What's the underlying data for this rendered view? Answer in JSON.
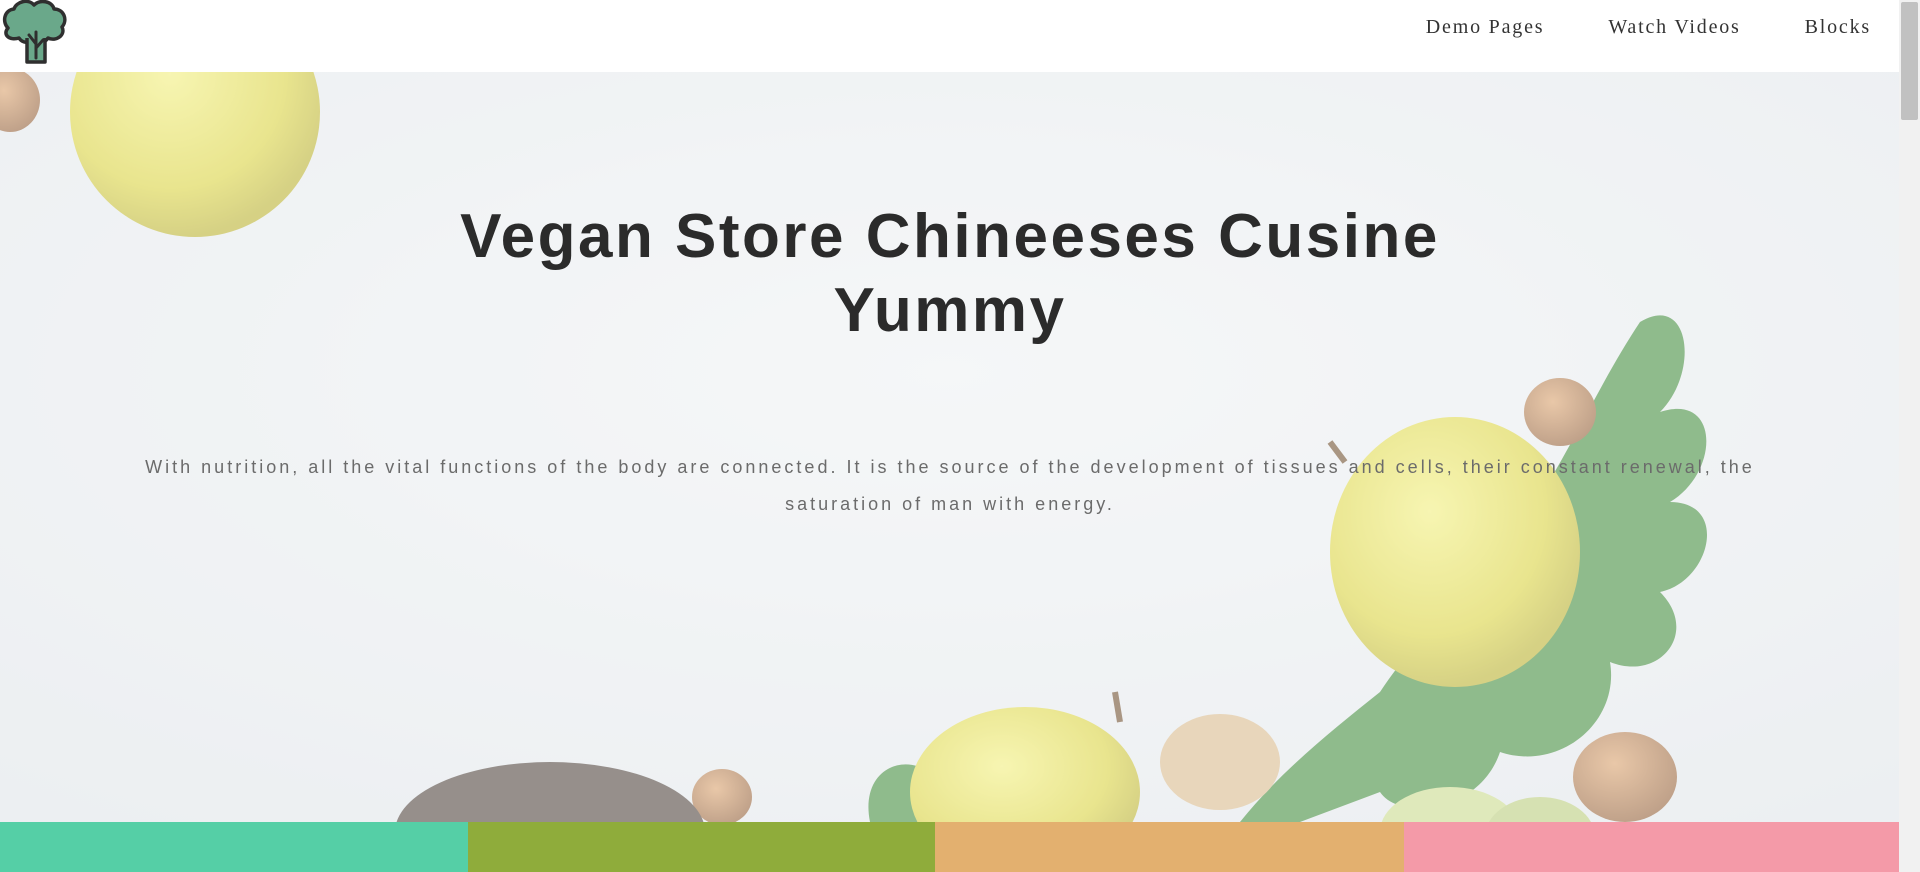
{
  "nav": {
    "items": [
      {
        "label": "Demo Pages"
      },
      {
        "label": "Watch Videos"
      },
      {
        "label": "Blocks"
      }
    ]
  },
  "hero": {
    "title": "Vegan Store Chineeses Cusine Yummy",
    "text": "With nutrition, all the vital functions of the body are connected. It is the source of the development of tissues and cells, their constant renewal, the saturation of man with energy."
  },
  "colors": {
    "logo": "#6aa88a",
    "bar_1": "#55cfa6",
    "bar_2": "#8fac3b",
    "bar_3": "#e3b06f",
    "bar_4": "#f49aa8",
    "title": "#2b2b2b",
    "text": "#6b6b6b"
  },
  "icons": {
    "logo": "broccoli-tree-icon"
  }
}
